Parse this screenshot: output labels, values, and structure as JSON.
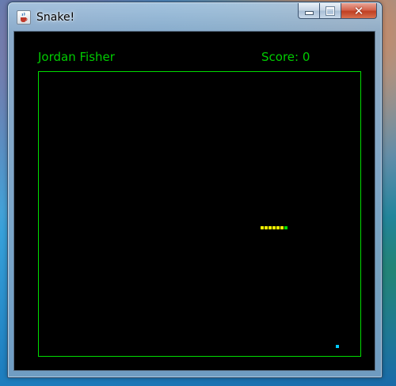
{
  "window": {
    "title": "Snake!",
    "app_icon": "java-cup-icon",
    "buttons": {
      "minimize": "minimize-icon",
      "maximize": "maximize-icon",
      "close": "close-icon",
      "close_glyph": "✕"
    }
  },
  "hud": {
    "player_name": "Jordan Fisher",
    "score_label": "Score: 0"
  },
  "game": {
    "colors": {
      "background": "#000000",
      "board_border": "#00dd00",
      "hud_text": "#00cc00",
      "snake_body": "#ffff00",
      "snake_head": "#00dd00",
      "food": "#00ccff"
    },
    "snake": {
      "length": 7,
      "head_cell": [
        62,
        39
      ],
      "direction": "right",
      "body_cells": [
        [
          56,
          39
        ],
        [
          57,
          39
        ],
        [
          58,
          39
        ],
        [
          59,
          39
        ],
        [
          60,
          39
        ],
        [
          61,
          39
        ]
      ]
    },
    "food_cell": [
      75,
      69
    ]
  }
}
